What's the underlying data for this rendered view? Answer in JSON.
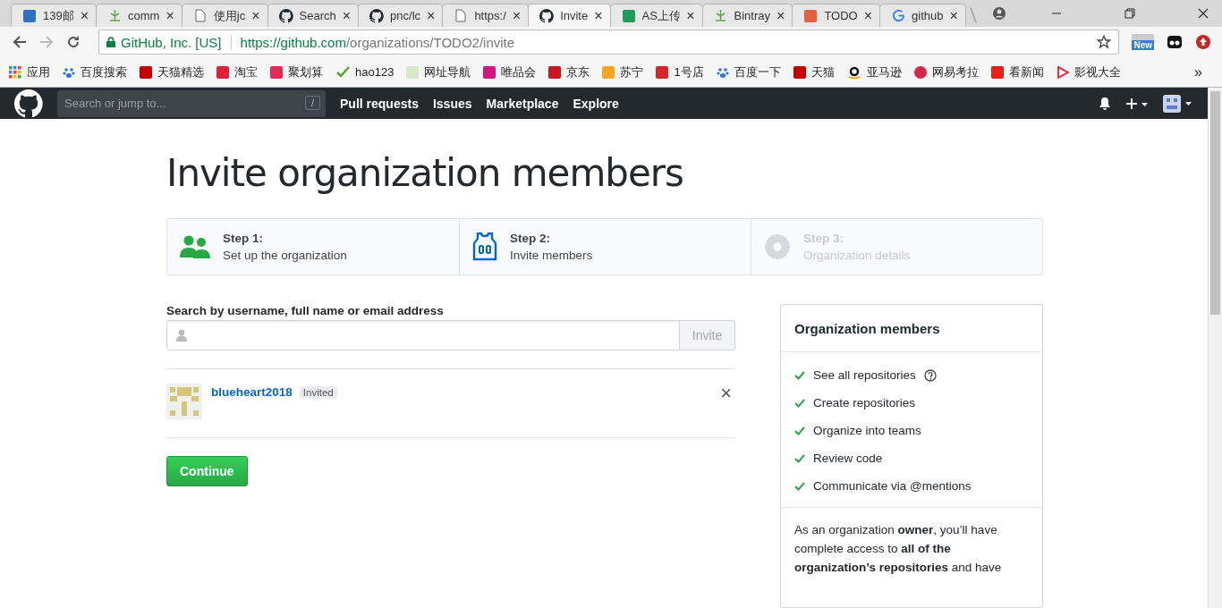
{
  "browser": {
    "tabs": [
      {
        "title": "139邮",
        "kind": "badge",
        "color": "#2f6fc4",
        "selected": false
      },
      {
        "title": "comm",
        "kind": "anchor",
        "selected": false
      },
      {
        "title": "使用jc",
        "kind": "doc",
        "selected": false
      },
      {
        "title": "Search",
        "kind": "github",
        "selected": false
      },
      {
        "title": "pnc/lc",
        "kind": "github",
        "selected": false
      },
      {
        "title": "https:/",
        "kind": "doc",
        "selected": false
      },
      {
        "title": "Invite",
        "kind": "github",
        "selected": true
      },
      {
        "title": "AS上传",
        "kind": "badge",
        "color": "#1e9c5a",
        "selected": false
      },
      {
        "title": "Bintray",
        "kind": "anchor",
        "selected": false
      },
      {
        "title": "TODO",
        "kind": "badge",
        "color": "#e4603f",
        "selected": false
      },
      {
        "title": "github",
        "kind": "google",
        "selected": false
      }
    ],
    "tab_close": "×",
    "address": {
      "site": "GitHub, Inc. [US]",
      "url_host": "https://github.com",
      "url_path": "/organizations/TODO2/invite"
    },
    "extension_badge": "New",
    "bookmarks": [
      {
        "label": "应用",
        "kind": "grid"
      },
      {
        "label": "百度搜索",
        "kind": "paw"
      },
      {
        "label": "天猫精选",
        "kind": "badge",
        "color": "#c40000"
      },
      {
        "label": "淘宝",
        "kind": "badge",
        "color": "#e0203a"
      },
      {
        "label": "聚划算",
        "kind": "badge",
        "color": "#e22a55"
      },
      {
        "label": "hao123",
        "kind": "check"
      },
      {
        "label": "网址导航",
        "kind": "badge",
        "color": "#d9e8c8"
      },
      {
        "label": "唯品会",
        "kind": "badge",
        "color": "#d1177e"
      },
      {
        "label": "京东",
        "kind": "badge",
        "color": "#c81623"
      },
      {
        "label": "苏宁",
        "kind": "badge",
        "color": "#f5a623"
      },
      {
        "label": "1号店",
        "kind": "badge",
        "color": "#d6262c"
      },
      {
        "label": "百度一下",
        "kind": "paw"
      },
      {
        "label": "天猫",
        "kind": "badge",
        "color": "#c40000"
      },
      {
        "label": "亚马逊",
        "kind": "amazon"
      },
      {
        "label": "网易考拉",
        "kind": "round",
        "color": "#d6264e"
      },
      {
        "label": "看新闻",
        "kind": "badge",
        "color": "#e8201c"
      },
      {
        "label": "影视大全",
        "kind": "play"
      }
    ],
    "more": "»"
  },
  "header": {
    "search_placeholder": "Search or jump to...",
    "slash_key": "/",
    "nav": [
      "Pull requests",
      "Issues",
      "Marketplace",
      "Explore"
    ]
  },
  "title": "Invite organization members",
  "steps": [
    {
      "label": "Step 1:",
      "desc": "Set up the organization",
      "kind": "people",
      "done": true,
      "current": false
    },
    {
      "label": "Step 2:",
      "desc": "Invite members",
      "kind": "jersey",
      "done": false,
      "current": true
    },
    {
      "label": "Step 3:",
      "desc": "Organization details",
      "kind": "gear",
      "done": false,
      "current": false
    }
  ],
  "search": {
    "label": "Search by username, full name or email address",
    "button": "Invite",
    "button_disabled": true
  },
  "invitees": [
    {
      "username": "blueheart2018",
      "badge": "Invited",
      "remove": "×"
    }
  ],
  "continue": "Continue",
  "sidebar": {
    "title": "Organization members",
    "permissions": [
      {
        "text": "See all repositories",
        "help": true
      },
      {
        "text": "Create repositories"
      },
      {
        "text": "Organize into teams"
      },
      {
        "text": "Review code"
      },
      {
        "text": "Communicate via @mentions"
      }
    ],
    "note": "As an organization **owner**, you’ll have complete access to **all of the organization’s repositories** and have"
  }
}
